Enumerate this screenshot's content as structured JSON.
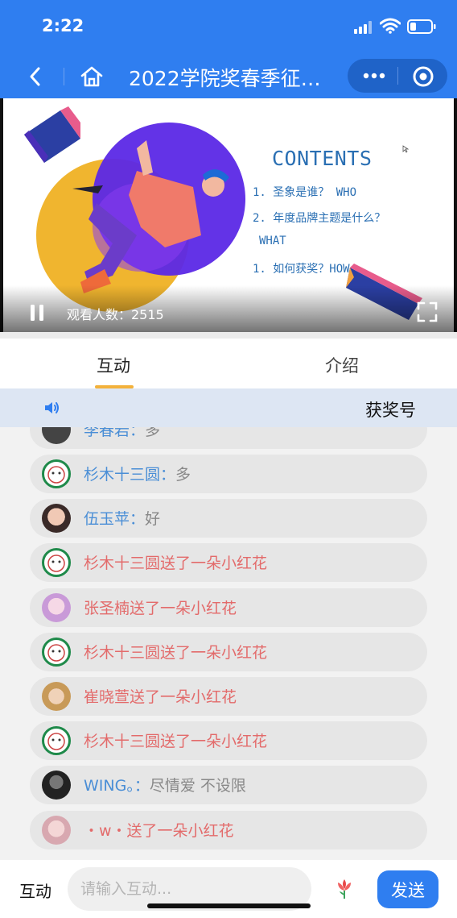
{
  "status": {
    "time": "2:22"
  },
  "nav": {
    "title": "2022学院奖春季征集...",
    "icons": [
      "back-chevron-icon",
      "home-icon",
      "more-dots-icon",
      "record-circle-icon"
    ]
  },
  "video": {
    "slide": {
      "title": "CONTENTS",
      "items": [
        "1. 圣象是谁？ WHO",
        "2. 年度品牌主题是什么？",
        "WHAT",
        "1. 如何获奖？HOW"
      ]
    },
    "viewers": "观看人数：2515"
  },
  "tabs": {
    "interact": "互动",
    "intro": "介绍"
  },
  "notice": {
    "text": "获奖号"
  },
  "messages": [
    {
      "name": "李春岩",
      "sep": "：",
      "text": "多",
      "gift": false
    },
    {
      "name": "杉木十三圆",
      "sep": "：",
      "text": "多",
      "gift": false
    },
    {
      "name": "伍玉苹",
      "sep": "：",
      "text": "好",
      "gift": false
    },
    {
      "name": "",
      "sep": "",
      "text": "杉木十三圆送了一朵小红花",
      "gift": true
    },
    {
      "name": "",
      "sep": "",
      "text": "张圣楠送了一朵小红花",
      "gift": true
    },
    {
      "name": "",
      "sep": "",
      "text": "杉木十三圆送了一朵小红花",
      "gift": true
    },
    {
      "name": "",
      "sep": "",
      "text": "崔晓萱送了一朵小红花",
      "gift": true
    },
    {
      "name": "",
      "sep": "",
      "text": "杉木十三圆送了一朵小红花",
      "gift": true
    },
    {
      "name": "WING。",
      "sep": "：",
      "text": "尽情爱 不设限",
      "gift": false
    },
    {
      "name": "",
      "sep": "",
      "text": "・w・送了一朵小红花",
      "gift": true
    }
  ],
  "bottom": {
    "label": "互动",
    "placeholder": "请输入互动...",
    "send": "发送"
  },
  "colors": {
    "brand": "#2f7ef0",
    "name": "#4a8ed6",
    "gift": "#e36b6b"
  }
}
